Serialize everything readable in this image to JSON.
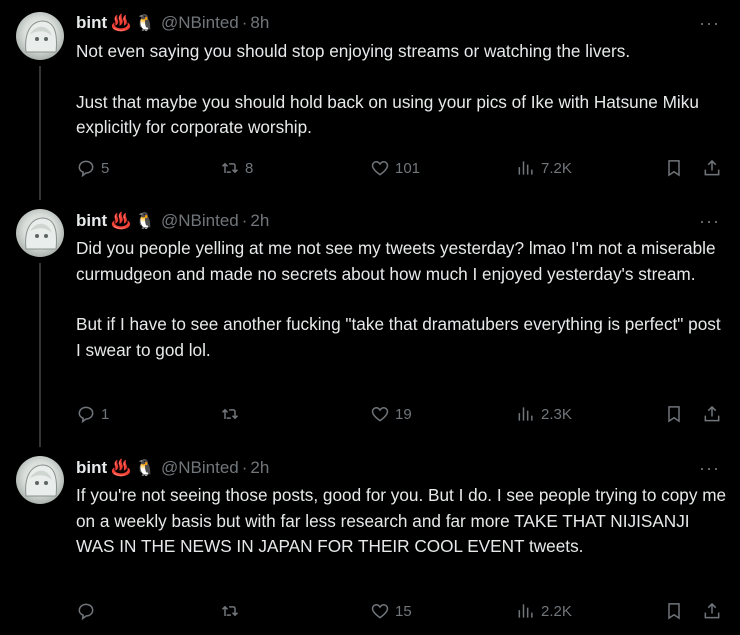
{
  "tweets": [
    {
      "name": "bint",
      "emoji1": "♨️",
      "emoji2": "🐧",
      "handle": "@NBinted",
      "time": "8h",
      "paragraphs": [
        "Not even saying you should stop enjoying streams or watching the livers.",
        "Just that maybe you should hold back on using your pics of Ike with Hatsune Miku explicitly for corporate worship."
      ],
      "replies": "5",
      "retweets": "8",
      "likes": "101",
      "views": "7.2K"
    },
    {
      "name": "bint",
      "emoji1": "♨️",
      "emoji2": "🐧",
      "handle": "@NBinted",
      "time": "2h",
      "paragraphs": [
        "Did you people yelling at me not see my tweets yesterday? lmao I'm not a miserable curmudgeon and made no secrets about how much I enjoyed yesterday's stream.",
        "But if I have to see another fucking \"take that dramatubers everything is perfect\" post I swear to god lol."
      ],
      "replies": "1",
      "retweets": "",
      "likes": "19",
      "views": "2.3K"
    },
    {
      "name": "bint",
      "emoji1": "♨️",
      "emoji2": "🐧",
      "handle": "@NBinted",
      "time": "2h",
      "paragraphs": [
        "If you're not seeing those posts, good for you. But I do. I see people trying to copy me on a weekly basis but with far less research and far more TAKE THAT NIJISANJI WAS IN THE NEWS IN JAPAN FOR THEIR COOL EVENT tweets."
      ],
      "replies": "",
      "retweets": "",
      "likes": "15",
      "views": "2.2K"
    }
  ],
  "icons": {
    "reply": "speech-bubble-icon",
    "retweet": "retweet-arrows-icon",
    "like": "heart-icon",
    "views": "bar-chart-icon",
    "bookmark": "bookmark-icon",
    "share": "share-upload-icon",
    "more": "ellipsis-icon"
  },
  "colors": {
    "background": "#000000",
    "text": "#e7e9ea",
    "muted": "#71767b",
    "thread_line": "#333639"
  },
  "more_glyph": "···"
}
